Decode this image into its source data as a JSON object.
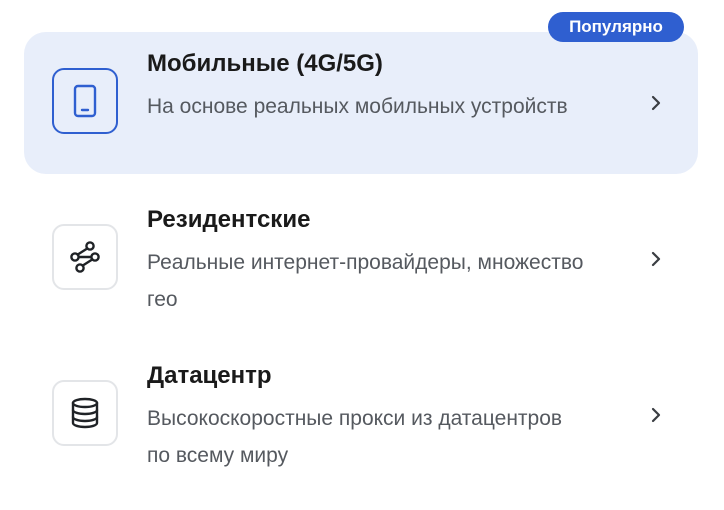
{
  "badge": {
    "label": "Популярно"
  },
  "options": [
    {
      "title": "Мобильные (4G/5G)",
      "description": "На основе реальных мобильных устройств",
      "icon": "smartphone-icon",
      "selected": true
    },
    {
      "title": "Резидентские",
      "description": "Реальные интернет-провайдеры, множество гео",
      "icon": "network-nodes-icon",
      "selected": false
    },
    {
      "title": "Датацентр",
      "description": "Высокоскоростные прокси из датацентров по всему миру",
      "icon": "database-icon",
      "selected": false
    }
  ],
  "colors": {
    "accent": "#2f5fd0",
    "selected_background": "#e8eefa",
    "title_text": "#1a1a1a",
    "description_text": "#55595f"
  }
}
